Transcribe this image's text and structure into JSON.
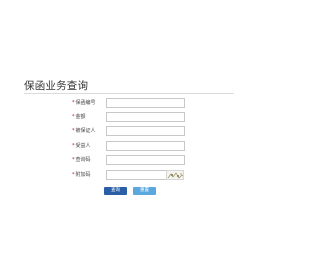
{
  "page": {
    "title": "保函业务查询"
  },
  "form": {
    "fields": [
      {
        "label": "保函编号",
        "required": "*",
        "value": ""
      },
      {
        "label": "金额",
        "required": "*",
        "value": ""
      },
      {
        "label": "被保证人",
        "required": "*",
        "value": ""
      },
      {
        "label": "受益人",
        "required": "*",
        "value": ""
      },
      {
        "label": "查询码",
        "required": "*",
        "value": ""
      },
      {
        "label": "附加码",
        "required": "*",
        "value": ""
      }
    ]
  },
  "buttons": {
    "search_label": "查询",
    "reset_label": "重置"
  },
  "colors": {
    "primary": "#2a5fa8",
    "secondary": "#5aa8de",
    "required": "#d0021b"
  }
}
